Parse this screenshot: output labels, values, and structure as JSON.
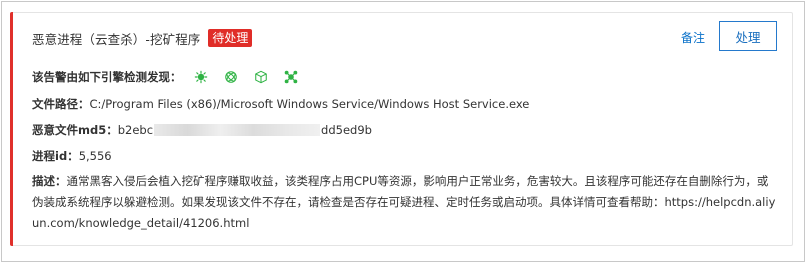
{
  "alert": {
    "title": "恶意进程（云查杀）-挖矿程序",
    "status_badge": "待处理",
    "note_label": "备注",
    "action_label": "处理"
  },
  "fields": {
    "engines_label": "该告警由如下引擎检测发现：",
    "engine_icons": [
      "virus-engine-icon",
      "cloud-engine-icon",
      "sandbox-cube-icon",
      "network-engine-icon"
    ],
    "path_label": "文件路径：",
    "path_value": "C:/Program Files (x86)/Microsoft Windows Service/Windows Host Service.exe",
    "md5_label": "恶意文件md5：",
    "md5_prefix": "b2ebc",
    "md5_suffix": "dd5ed9b",
    "pid_label": "进程id：",
    "pid_value": "5,556",
    "desc_label": "描述：",
    "desc_value": "通常黑客入侵后会植入挖矿程序赚取收益，该类程序占用CPU等资源，影响用户正常业务，危害较大。且该程序可能还存在自删除行为，或伪装成系统程序以躲避检测。如果发现该文件不存在，请检查是否存在可疑进程、定时任务或启动项。具体详情可查看帮助：https://help­cdn.aliyun.com/knowledge_detail/41206.html"
  },
  "colors": {
    "accent": "#e0302b",
    "badge": "#e02d28",
    "link": "#0a71c9",
    "engine_icon": "#2fb344"
  }
}
